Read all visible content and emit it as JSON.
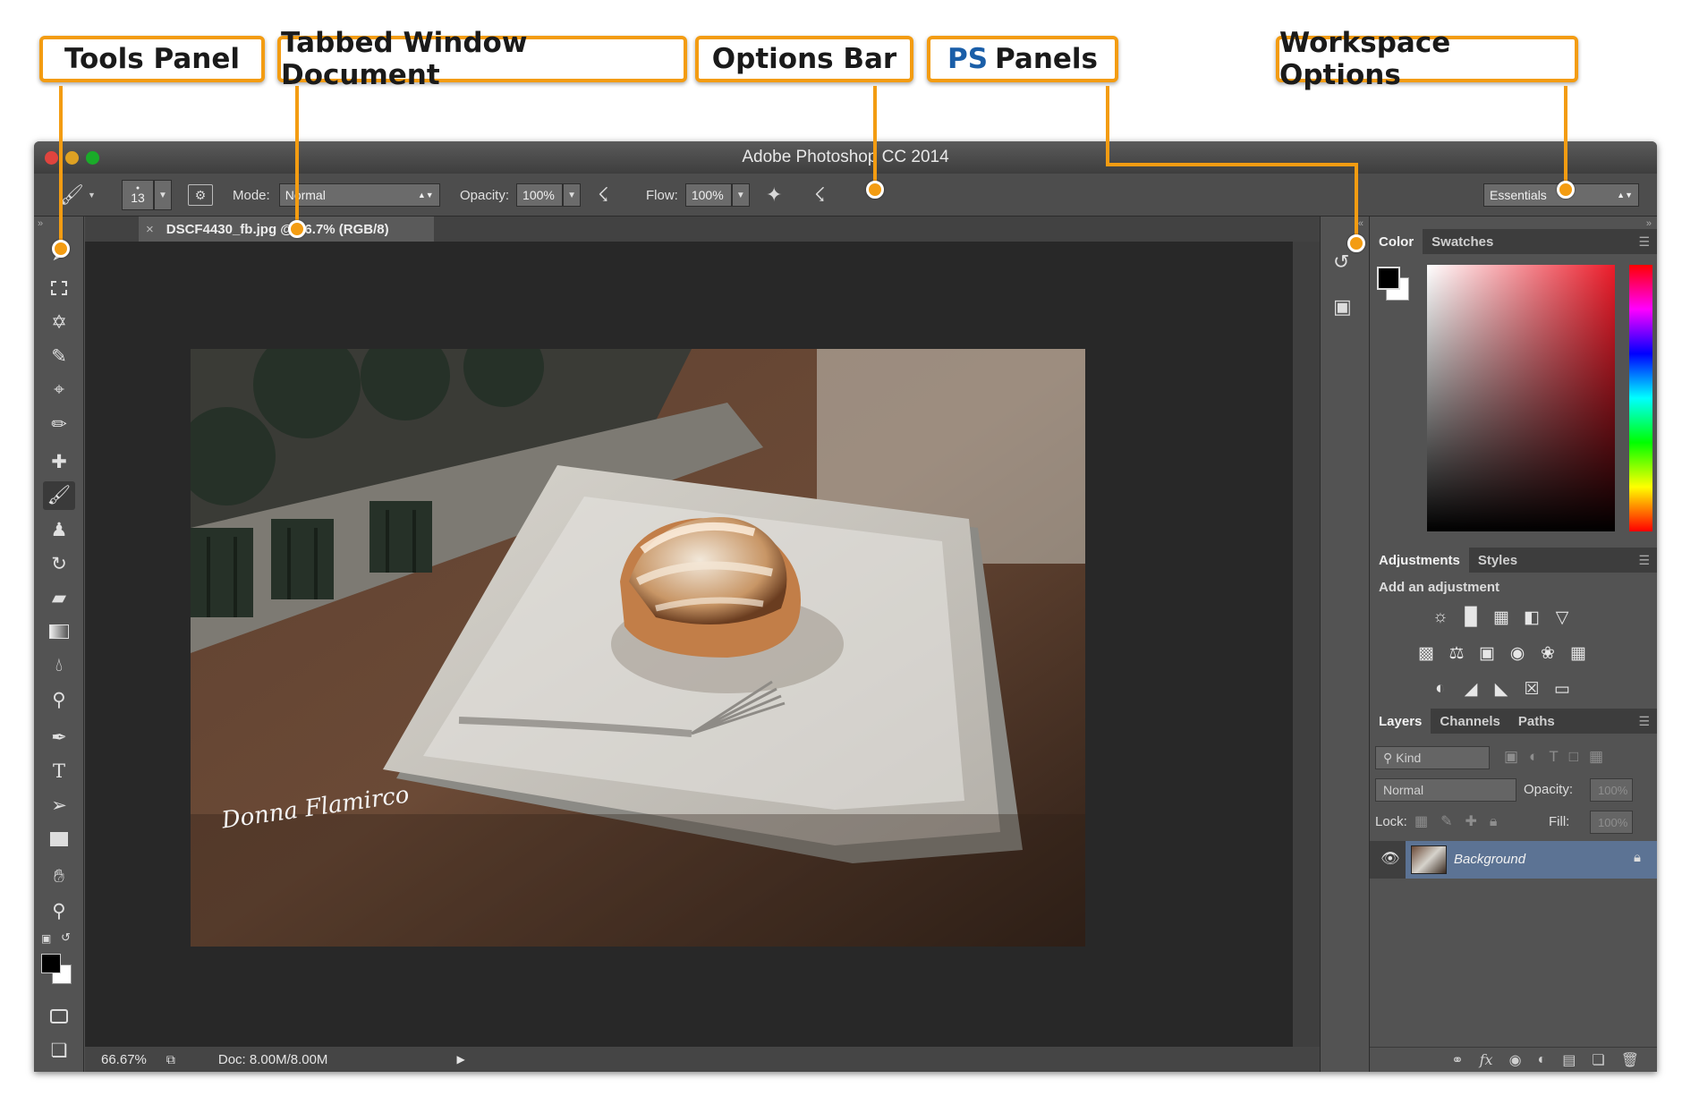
{
  "callouts": {
    "tools_panel": "Tools Panel",
    "tabbed_window": "Tabbed Window Document",
    "options_bar": "Options Bar",
    "ps_prefix": "PS",
    "ps_panels": "Panels",
    "workspace_options": "Workspace Options"
  },
  "app": {
    "title": "Adobe Photoshop CC 2014"
  },
  "options_bar": {
    "brush_size": "13",
    "mode_label": "Mode:",
    "mode_value": "Normal",
    "opacity_label": "Opacity:",
    "opacity_value": "100%",
    "flow_label": "Flow:",
    "flow_value": "100%",
    "workspace_value": "Essentials"
  },
  "document": {
    "tab_title": "DSCF4430_fb.jpg @ 66.7% (RGB/8)",
    "signature": "Donna Flamirco"
  },
  "status_bar": {
    "zoom": "66.67%",
    "doc_size": "Doc: 8.00M/8.00M"
  },
  "panels": {
    "color_tab": "Color",
    "swatches_tab": "Swatches",
    "adjustments_tab": "Adjustments",
    "styles_tab": "Styles",
    "add_adjustment": "Add an adjustment",
    "layers_tab": "Layers",
    "channels_tab": "Channels",
    "paths_tab": "Paths",
    "kind_filter": "Kind",
    "blend_mode": "Normal",
    "opacity_label": "Opacity:",
    "opacity_value": "100%",
    "lock_label": "Lock:",
    "fill_label": "Fill:",
    "fill_value": "100%",
    "layer_name": "Background"
  },
  "colors": {
    "accent": "#f39c12",
    "ps_blue": "#1a5ea8",
    "panel_bg": "#535353",
    "canvas_bg": "#282828",
    "selected_layer": "#5c7394"
  }
}
